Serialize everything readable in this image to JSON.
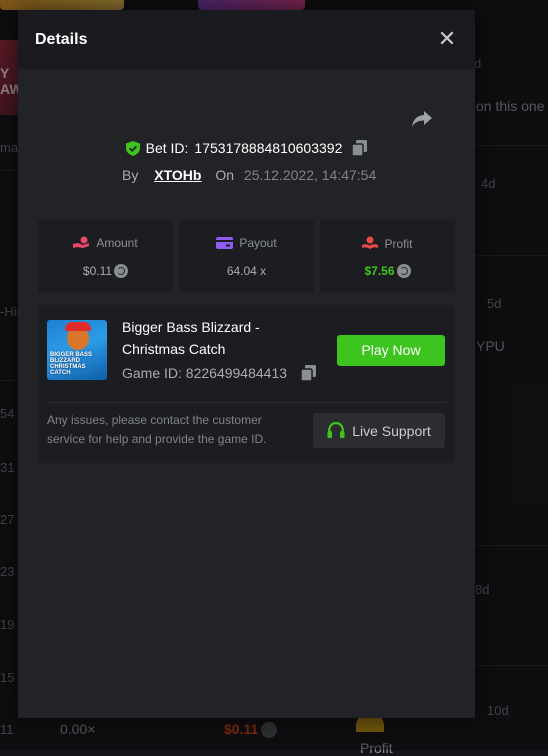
{
  "background": {
    "promo_letters": "Y\nAW",
    "left_labels": [
      "ma",
      "-Hig"
    ],
    "left_numbers": [
      "54",
      "31",
      "27",
      "23",
      "19",
      "15",
      "11"
    ],
    "right_labels": [
      "d",
      "on this one",
      "4d",
      "YPU",
      "5d",
      "8d",
      "10d"
    ],
    "bottom_multiplier": "0.00×",
    "bottom_amount": "$0.11",
    "bottom_profit_label": "Profit"
  },
  "modal": {
    "title": "Details",
    "bet": {
      "label": "Bet ID:",
      "id": "1753178884810603392",
      "by_label": "By",
      "user": "XTOHb",
      "on_label": "On",
      "date": "25.12.2022, 14:47:54"
    },
    "stats": [
      {
        "label": "Amount",
        "value": "$0.11",
        "icon": "amount-icon",
        "icon_color": "#e8476b"
      },
      {
        "label": "Payout",
        "value": "64.04 x",
        "icon": "payout-icon",
        "icon_color": "#8d5cf6"
      },
      {
        "label": "Profit",
        "value": "$7.56",
        "icon": "profit-icon",
        "icon_color": "#e84848"
      }
    ],
    "game": {
      "thumb_text": "BIGGER BASS BLIZZARD CHRISTMAS CATCH",
      "title": "Bigger Bass Blizzard - Christmas Catch",
      "id_label": "Game ID:",
      "id": "8226499484413",
      "play_label": "Play Now",
      "issues_text": "Any issues, please contact the customer service for help and provide the game ID.",
      "support_label": "Live Support"
    }
  },
  "colors": {
    "accent_green": "#3ec41f",
    "modal_bg": "#222326",
    "card_bg": "#1c1d20"
  }
}
